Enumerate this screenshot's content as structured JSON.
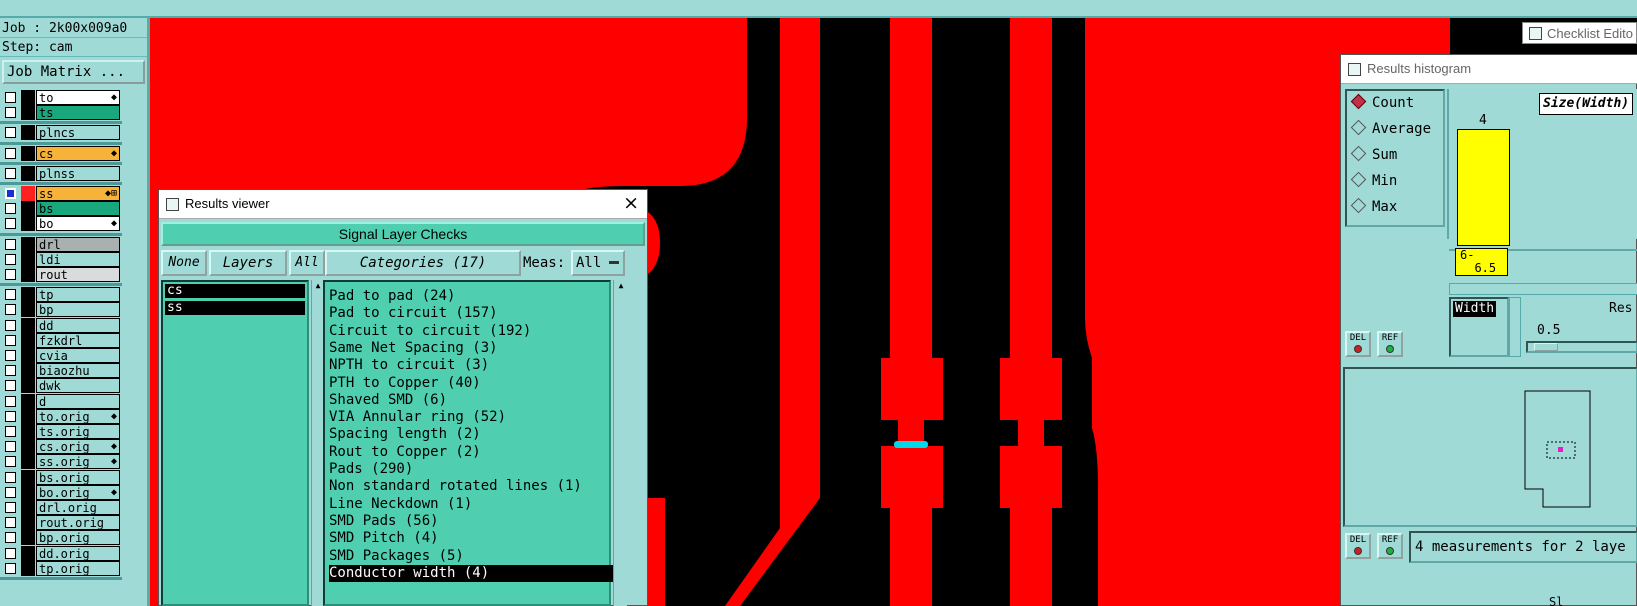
{
  "top_strip": {},
  "left_panel": {
    "job": "Job : 2k00x009a0",
    "step": "Step: cam",
    "job_matrix_label": "Job Matrix ...",
    "groups": [
      [
        {
          "name": "to",
          "bg": "#ffffff",
          "mark": "◆"
        },
        {
          "name": "ts",
          "bg": "#19a77e",
          "mark": ""
        }
      ],
      [
        {
          "name": "plncs",
          "bg": "#9fdad6",
          "mark": ""
        }
      ],
      [
        {
          "name": "cs",
          "bg": "#f7b23a",
          "mark": "◆"
        }
      ],
      [
        {
          "name": "plnss",
          "bg": "#9fdad6",
          "mark": ""
        }
      ],
      [
        {
          "name": "ss",
          "bg": "#f7b23a",
          "mark": "◆⊞",
          "active": true
        },
        {
          "name": "bs",
          "bg": "#19a77e",
          "mark": ""
        },
        {
          "name": "bo",
          "bg": "#ffffff",
          "mark": "◆"
        }
      ],
      [
        {
          "name": "drl",
          "bg": "#a9b0b0",
          "mark": ""
        },
        {
          "name": "ldi",
          "bg": "#9fdad6",
          "mark": ""
        },
        {
          "name": "rout",
          "bg": "#d9dcdc",
          "mark": ""
        }
      ],
      [
        {
          "name": "tp",
          "bg": "#9fdad6",
          "mark": ""
        },
        {
          "name": "bp",
          "bg": "#9fdad6",
          "mark": ""
        },
        {
          "name": "dd",
          "bg": "#9fdad6",
          "mark": ""
        },
        {
          "name": "fzkdrl",
          "bg": "#9fdad6",
          "mark": ""
        },
        {
          "name": "cvia",
          "bg": "#9fdad6",
          "mark": ""
        },
        {
          "name": "biaozhu",
          "bg": "#9fdad6",
          "mark": ""
        },
        {
          "name": "dwk",
          "bg": "#9fdad6",
          "mark": ""
        },
        {
          "name": "d",
          "bg": "#9fdad6",
          "mark": ""
        },
        {
          "name": "to.orig",
          "bg": "#9fdad6",
          "mark": "◆"
        },
        {
          "name": "ts.orig",
          "bg": "#9fdad6",
          "mark": ""
        },
        {
          "name": "cs.orig",
          "bg": "#9fdad6",
          "mark": "◆"
        },
        {
          "name": "ss.orig",
          "bg": "#9fdad6",
          "mark": "◆"
        },
        {
          "name": "bs.orig",
          "bg": "#9fdad6",
          "mark": ""
        },
        {
          "name": "bo.orig",
          "bg": "#9fdad6",
          "mark": "◆"
        },
        {
          "name": "drl.orig",
          "bg": "#9fdad6",
          "mark": ""
        },
        {
          "name": "rout.orig",
          "bg": "#9fdad6",
          "mark": ""
        },
        {
          "name": "bp.orig",
          "bg": "#9fdad6",
          "mark": ""
        },
        {
          "name": "dd.orig",
          "bg": "#9fdad6",
          "mark": ""
        },
        {
          "name": "tp.orig",
          "bg": "#9fdad6",
          "mark": ""
        }
      ]
    ]
  },
  "results_viewer": {
    "title": "Results viewer",
    "close": "×",
    "section": "Signal Layer Checks",
    "none_btn": "None",
    "layers_btn": "Layers",
    "all_btn": "All",
    "categories_btn": "Categories (17)",
    "meas_label": "Meas:",
    "meas_value": "All",
    "layers": [
      "cs",
      "ss"
    ],
    "categories": [
      "Pad to pad (24)",
      "Pad to circuit (157)",
      "Circuit to circuit (192)",
      "Same Net Spacing (3)",
      "NPTH to circuit (3)",
      "PTH to Copper (40)",
      "Shaved SMD (6)",
      "VIA Annular ring (52)",
      "Spacing length (2)",
      "Rout to Copper (2)",
      "Pads (290)",
      "Non standard rotated lines (1)",
      "Line Neckdown (1)",
      "SMD Pads (56)",
      "SMD Pitch (4)",
      "SMD Packages (5)",
      "Conductor width (4)"
    ],
    "selected_category": 16
  },
  "checklist_editor": {
    "title": "Checklist Edito"
  },
  "results_histogram": {
    "title": "Results histogram",
    "modes": [
      "Count",
      "Average",
      "Sum",
      "Min",
      "Max"
    ],
    "selected_mode": 0,
    "size_label": "Size(Width)",
    "bar_count_label": "4",
    "bar_range_label": "6-\n  6.5",
    "bar_color": "#ffff00",
    "width_label": "Width",
    "res_label": "Res",
    "res_value": "0.5",
    "del_label": "DEL",
    "ref_label": "REF",
    "status": "4 measurements for 2 laye",
    "bottom_partial": "Sl"
  },
  "colors": {
    "panel_bg": "#9fdad6",
    "teal": "#4fcfb0",
    "copper": "#ff0000",
    "board_bg": "#000000",
    "highlight": "#00d8e8"
  }
}
